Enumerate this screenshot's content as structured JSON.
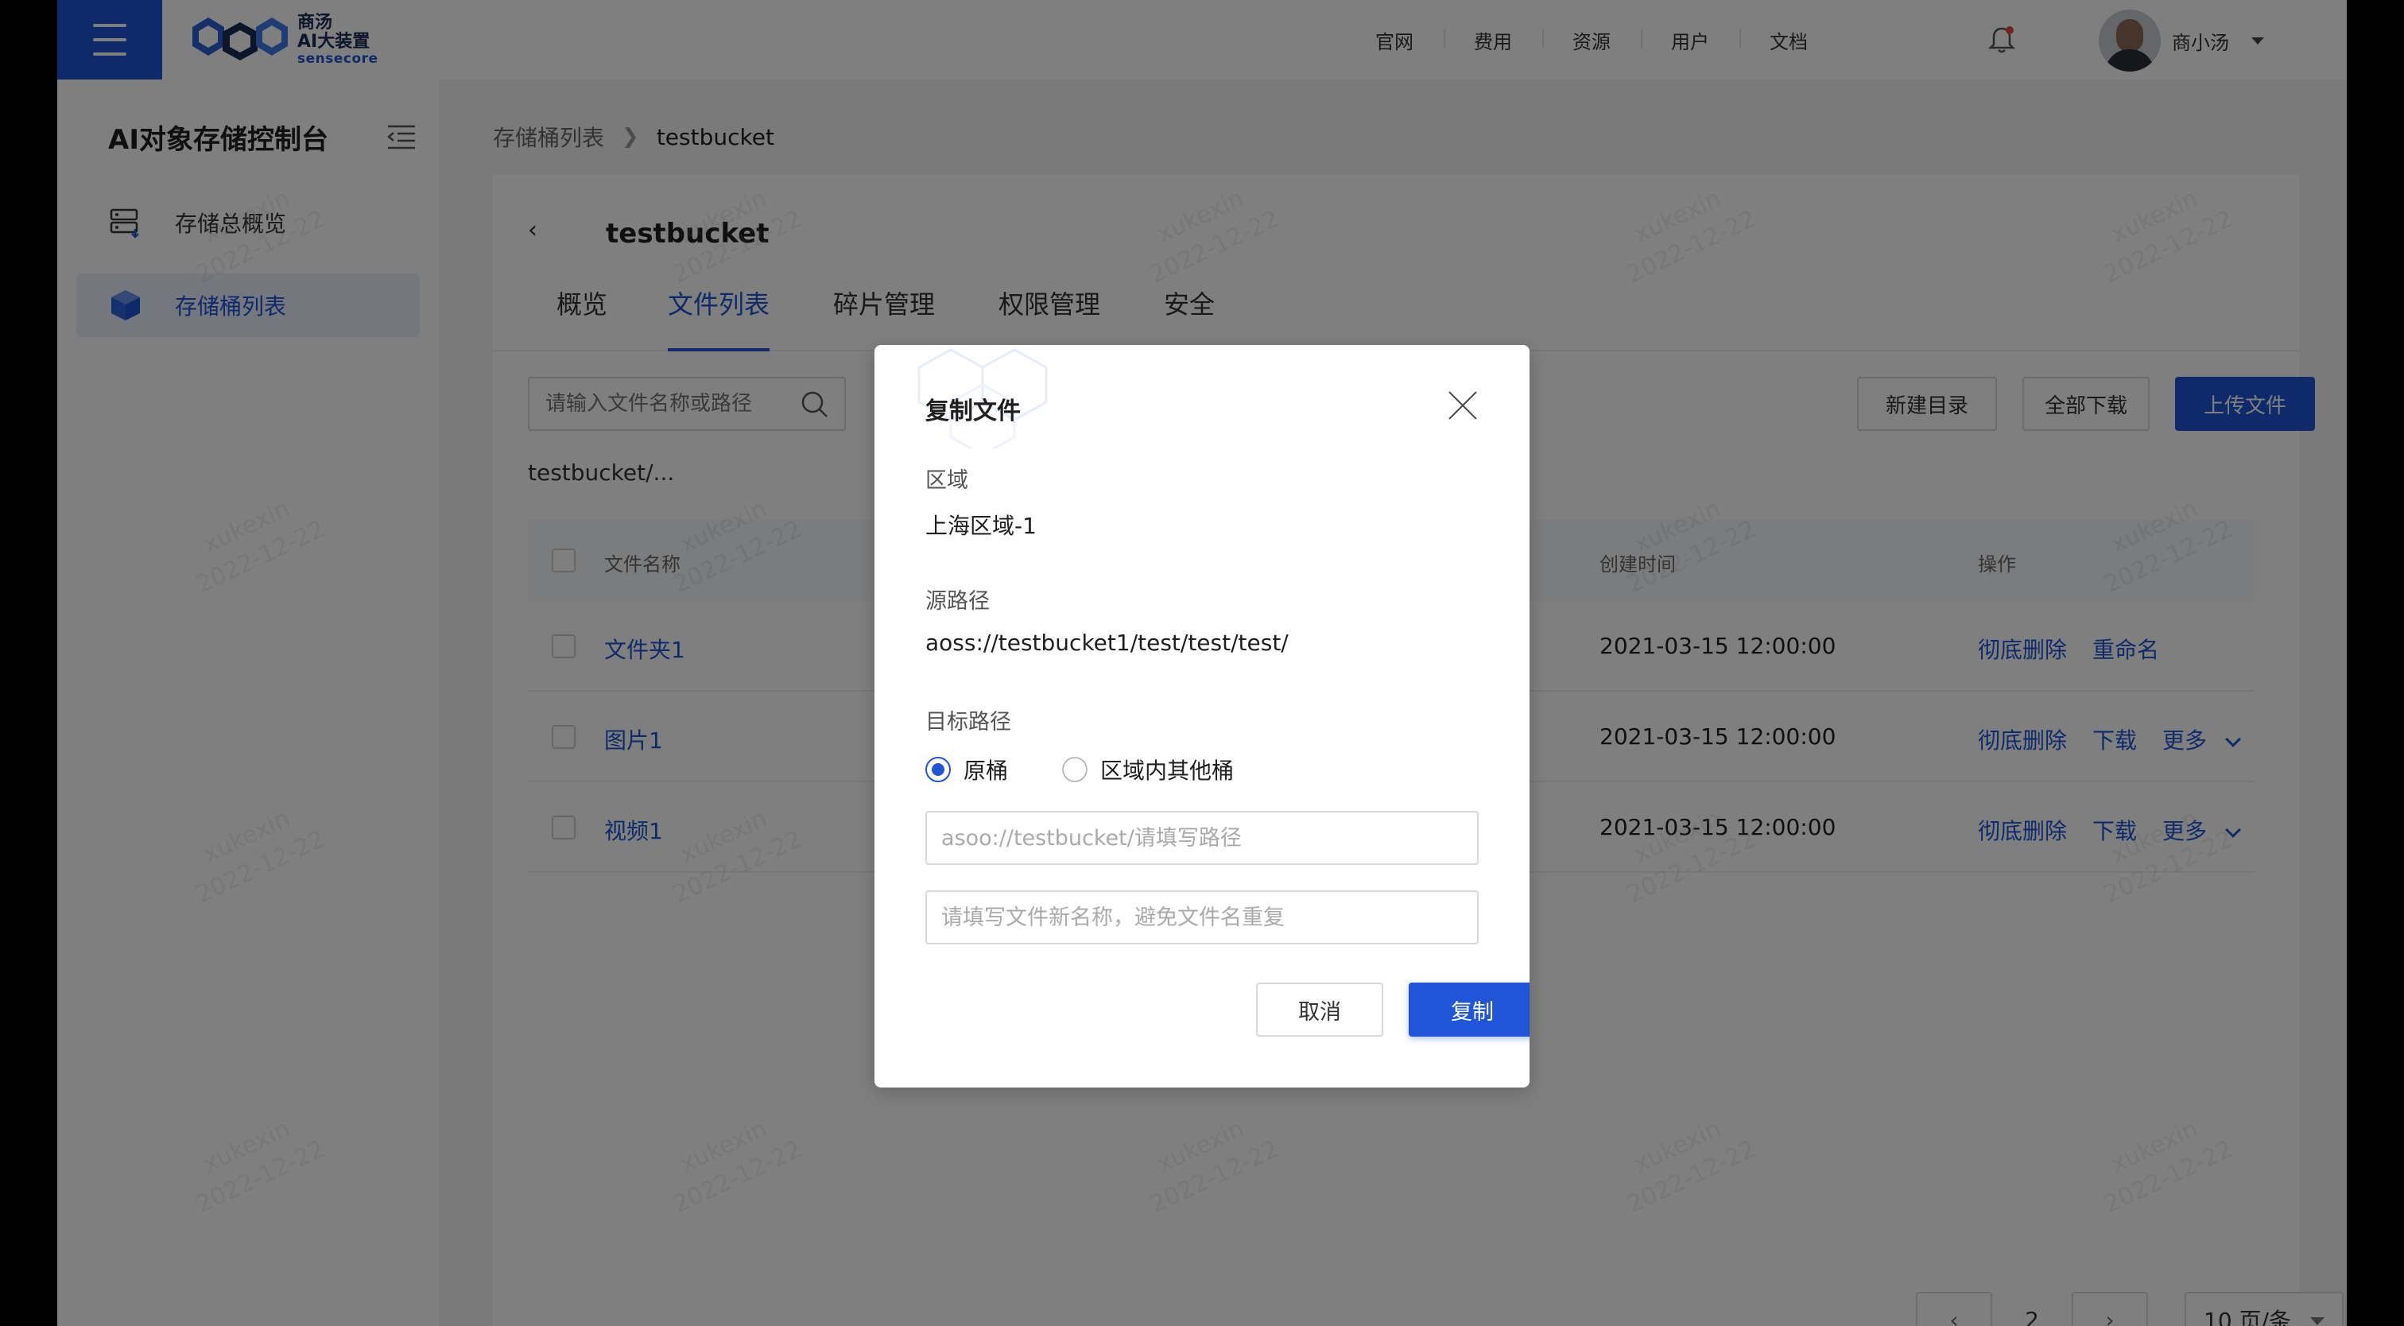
{
  "topbar": {
    "logo": {
      "line1": "商汤",
      "line2": "AI大装置",
      "line3": "sensecore"
    },
    "nav": [
      "官网",
      "费用",
      "资源",
      "用户",
      "文档"
    ],
    "user_name": "商小汤"
  },
  "sidebar": {
    "title": "AI对象存储控制台",
    "items": [
      {
        "label": "存储总概览",
        "icon": "storage-overview-icon"
      },
      {
        "label": "存储桶列表",
        "icon": "bucket-cube-icon",
        "active": true
      }
    ]
  },
  "breadcrumb": {
    "parent": "存储桶列表",
    "current": "testbucket"
  },
  "bucket": {
    "title": "testbucket",
    "tabs": [
      "概览",
      "文件列表",
      "碎片管理",
      "权限管理",
      "安全"
    ],
    "active_tab": "文件列表"
  },
  "toolbar": {
    "search_placeholder": "请输入文件名称或路径",
    "new_dir": "新建目录",
    "download_all": "全部下载",
    "upload": "上传文件"
  },
  "path": "testbucket/...",
  "table": {
    "headers": {
      "name": "文件名称",
      "created": "创建时间",
      "ops": "操作"
    },
    "rows": [
      {
        "name": "文件夹1",
        "created": "2021-03-15 12:00:00",
        "ops": [
          "彻底删除",
          "重命名"
        ]
      },
      {
        "name": "图片1",
        "created": "2021-03-15 12:00:00",
        "ops": [
          "彻底删除",
          "下载",
          "更多"
        ]
      },
      {
        "name": "视频1",
        "created": "2021-03-15 12:00:00",
        "ops": [
          "彻底删除",
          "下载",
          "更多"
        ]
      }
    ]
  },
  "pagination": {
    "page": "2",
    "page_size": "10 页/条"
  },
  "watermark": {
    "name": "xukexin",
    "date": "2022-12-22"
  },
  "modal": {
    "title": "复制文件",
    "region_label": "区域",
    "region_value": "上海区域-1",
    "source_label": "源路径",
    "source_value": "aoss://testbucket1/test/test/test/",
    "target_label": "目标路径",
    "radio_options": [
      "原桶",
      "区域内其他桶"
    ],
    "selected_option": "原桶",
    "path_placeholder": "asoo://testbucket/请填写路径",
    "name_placeholder": "请填写文件新名称，避免文件名重复",
    "cancel": "取消",
    "confirm": "复制"
  },
  "colors": {
    "primary": "#1f55d6",
    "overlay": "rgba(0,0,0,0.5)"
  }
}
